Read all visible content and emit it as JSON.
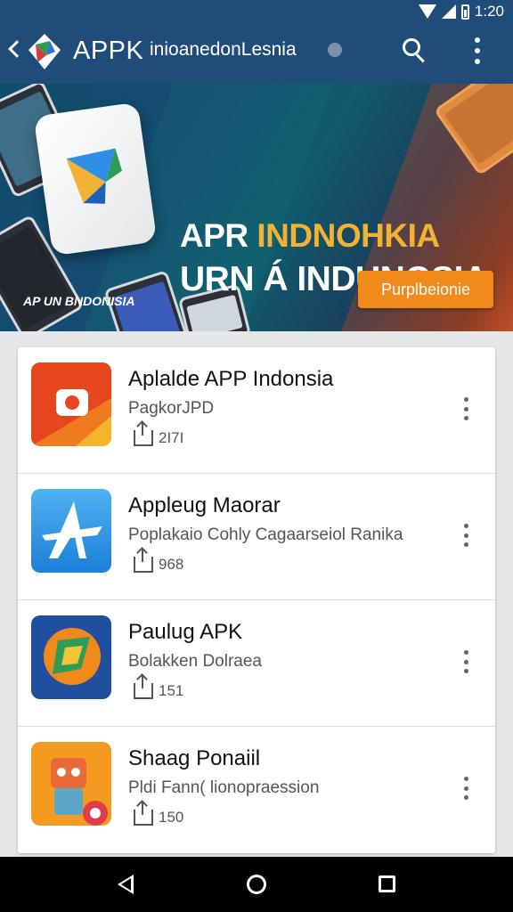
{
  "status_bar": {
    "time": "1:20",
    "icons": [
      "wifi-icon",
      "signal-icon",
      "battery-icon"
    ]
  },
  "app_bar": {
    "title": "APPK",
    "subtitle": "inioanedonLesnia",
    "icons": [
      "back-arrow-icon",
      "app-logo-icon",
      "info-icon",
      "search-icon",
      "more-vert-icon"
    ]
  },
  "banner": {
    "headline_white": "APR ",
    "headline_highlight": "INDNOHKIA",
    "headline_line2": "URN Á INDUNOSIA",
    "caption": "AP UN BNDONISIA",
    "button_label": "Purplbeionie",
    "colors": {
      "highlight": "#f2b233",
      "button": "#f08a1b"
    }
  },
  "apps": [
    {
      "title": "Aplalde APP Indonsia",
      "subtitle": "PagkorJPD",
      "count": "2I7I",
      "icon": "camera-app-icon"
    },
    {
      "title": "Appleug Maorar",
      "subtitle": "Poplakaio Cohly Cagaarseiol Ranika",
      "count": "968",
      "icon": "star-app-icon"
    },
    {
      "title": "Paulug APK",
      "subtitle": "Bolakken Dolraea",
      "count": "151",
      "icon": "folded-square-app-icon"
    },
    {
      "title": "Shaag Ponaiil",
      "subtitle": "Pldi Fann( lionopraession",
      "count": "150",
      "icon": "robot-app-icon"
    }
  ],
  "nav_bar": {
    "icons": [
      "nav-back-icon",
      "nav-home-icon",
      "nav-recents-icon"
    ]
  },
  "theme": {
    "primary": "#1f4c78",
    "background": "#e6e7e8"
  }
}
